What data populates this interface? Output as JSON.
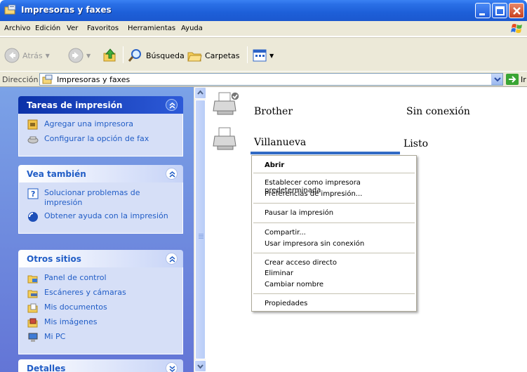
{
  "window": {
    "title": "Impresoras y faxes",
    "buttons": {
      "minimize": "minimize-icon",
      "maximize": "maximize-icon",
      "close": "close-icon"
    }
  },
  "menubar": {
    "items": [
      "Archivo",
      "Edición",
      "Ver",
      "Favoritos",
      "Herramientas",
      "Ayuda"
    ]
  },
  "toolbar": {
    "back_label": "Atrás",
    "search_label": "Búsqueda",
    "folders_label": "Carpetas"
  },
  "address": {
    "label": "Dirección",
    "value": "Impresoras y faxes",
    "go_label": "Ir"
  },
  "taskpane": {
    "print_tasks": {
      "title": "Tareas de impresión",
      "links": [
        "Agregar una impresora",
        "Configurar la opción de fax"
      ]
    },
    "see_also": {
      "title": "Vea también",
      "links": [
        "Solucionar problemas de impresión",
        "Obtener ayuda con la impresión"
      ]
    },
    "other_places": {
      "title": "Otros sitios",
      "links": [
        "Panel de control",
        "Escáneres y cámaras",
        "Mis documentos",
        "Mis imágenes",
        "Mi PC"
      ]
    },
    "details": {
      "title": "Detalles"
    }
  },
  "printers": [
    {
      "name": "Brother",
      "status": "Sin conexión"
    },
    {
      "name": "Villanueva",
      "status": "Listo"
    }
  ],
  "context_menu": {
    "items": [
      "Abrir",
      "Establecer como impresora predeterminada",
      "Preferencias de impresión...",
      "Pausar la impresión",
      "Compartir...",
      "Usar impresora sin conexión",
      "Crear acceso directo",
      "Eliminar",
      "Cambiar nombre",
      "Propiedades"
    ]
  },
  "colors": {
    "titlebar": "#1d5fd8",
    "taskpane_bg": "#6f8ee0",
    "link": "#215dc6",
    "selection": "#316ac5"
  }
}
